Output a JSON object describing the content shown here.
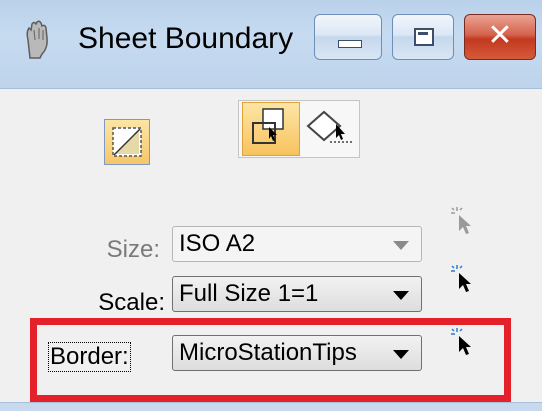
{
  "window": {
    "title": "Sheet Boundary",
    "controls": {
      "minimize": "minimize-icon",
      "maximize": "maximize-icon",
      "close": "close-icon"
    }
  },
  "toolbar": {
    "single_tool": "place-rectangle-icon",
    "group_tools": [
      "place-sheet-boundary-icon",
      "modify-boundary-icon"
    ],
    "active_group_tool": "place-sheet-boundary-icon"
  },
  "form": {
    "size": {
      "label": "Size:",
      "value": "ISO A2",
      "enabled": false
    },
    "scale": {
      "label": "Scale:",
      "value": "Full Size 1=1",
      "enabled": true
    },
    "border": {
      "label": "Border:",
      "value": "MicroStationTips",
      "enabled": true
    }
  },
  "colors": {
    "highlight": "#e4202a",
    "titlebar": "#c6dbf0",
    "close_button": "#c2391f",
    "active_tool": "#f7c35e"
  }
}
